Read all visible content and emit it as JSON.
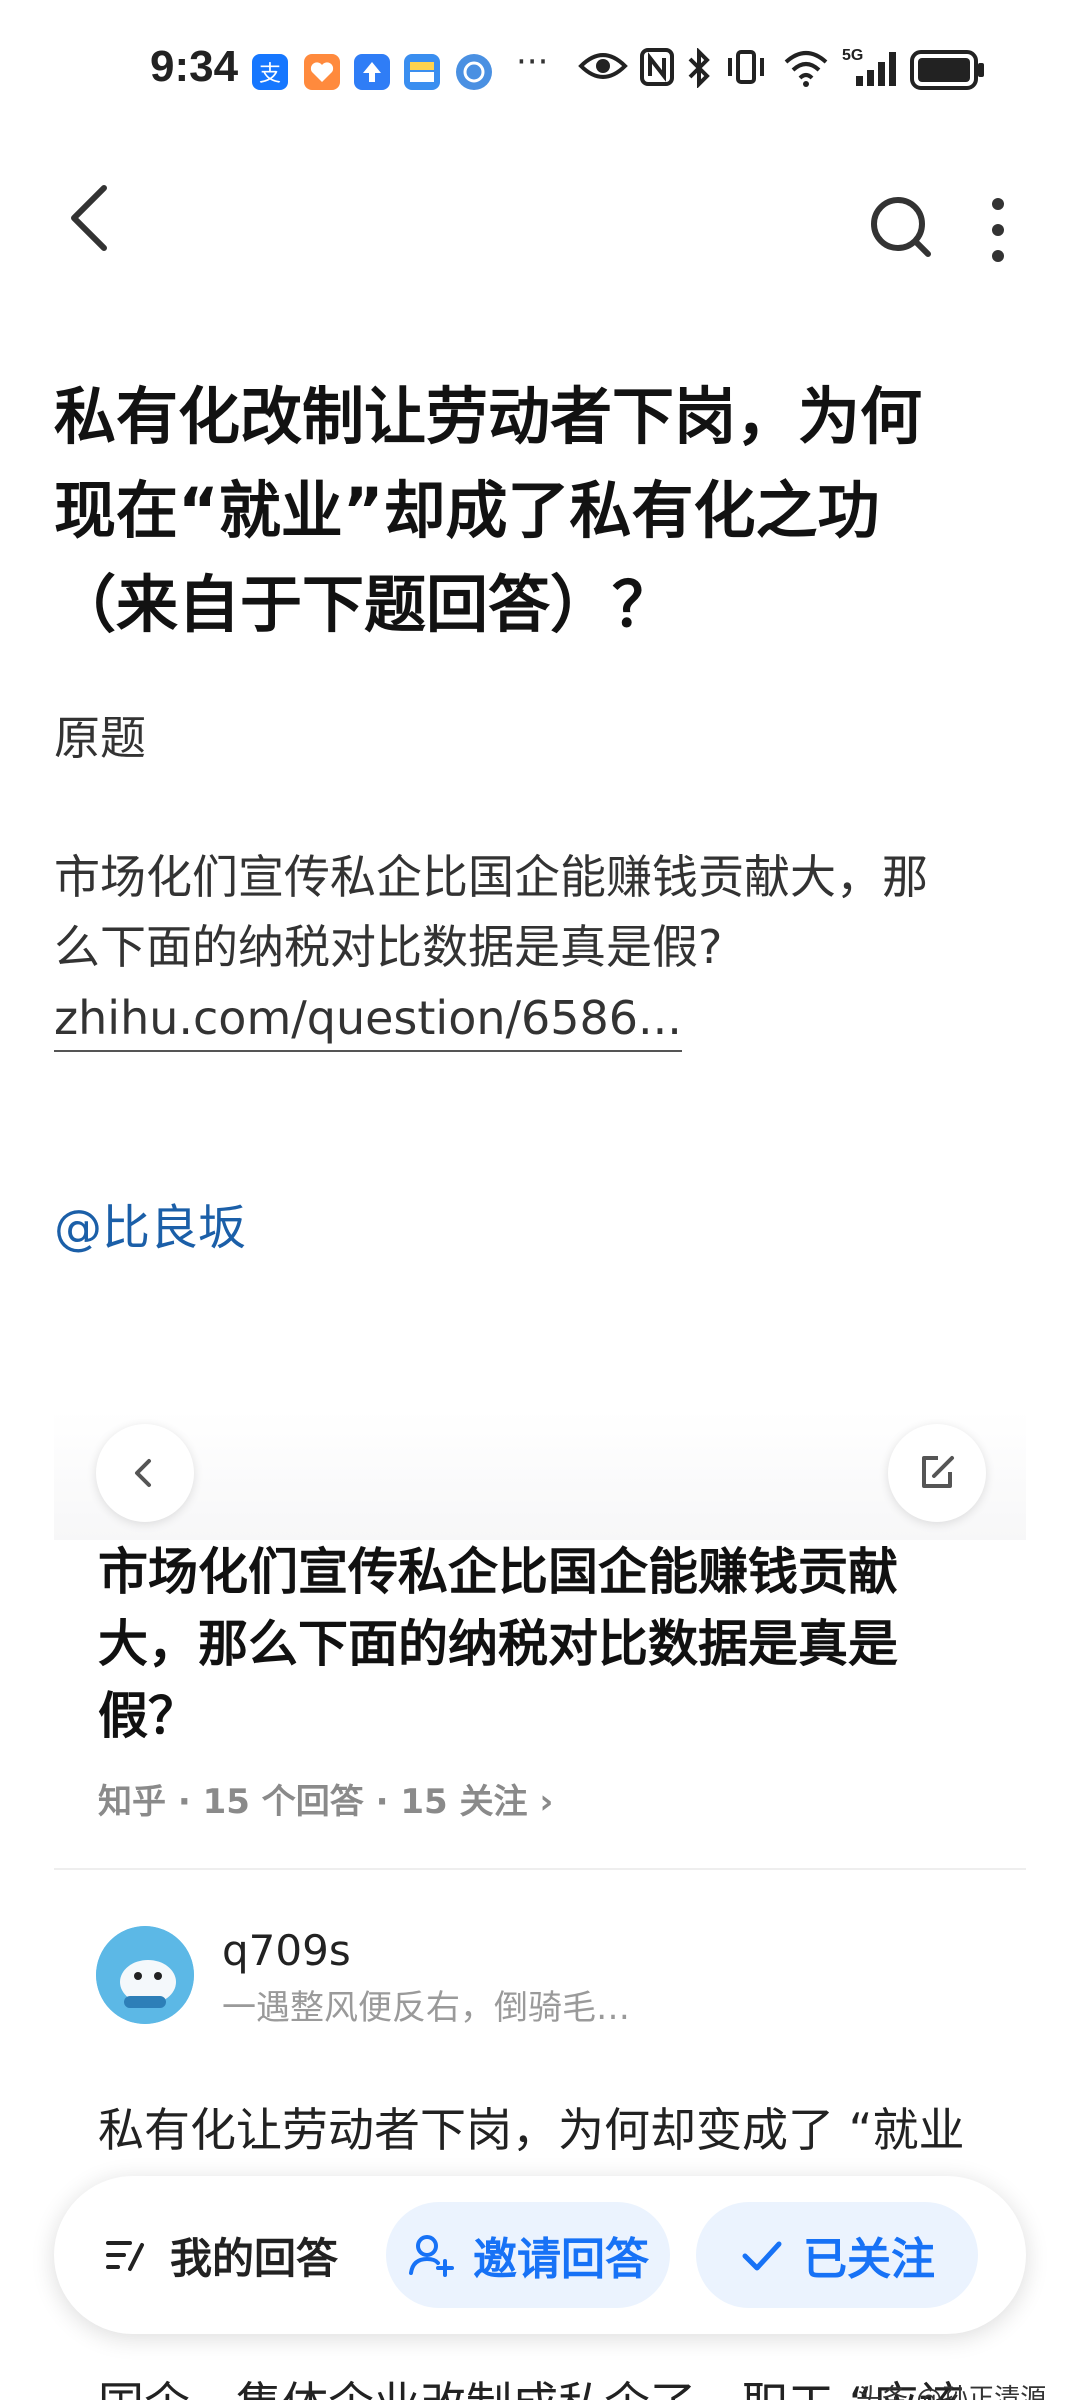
{
  "status_bar": {
    "time": "9:34",
    "overflow": "···",
    "app_icons": [
      "alipay-icon",
      "health-icon",
      "upload-icon",
      "wallet-icon",
      "browser-icon"
    ],
    "network_label": "5G",
    "indicators": [
      "eye-icon",
      "nfc-icon",
      "bluetooth-icon",
      "vibrate-icon",
      "wifi-icon",
      "signal-icon",
      "battery-icon"
    ]
  },
  "nav": {
    "back_icon": "chevron-left-icon",
    "search_icon": "search-icon",
    "more_icon": "more-vertical-icon"
  },
  "article": {
    "title_lines": [
      "私有化改制让劳动者下岗，为何",
      "现在“就业”却成了私有化之功",
      "（来自于下题回答）？"
    ],
    "section_label": "原题",
    "question_lines": [
      "市场化们宣传私企比国企能赚钱贡献大，那",
      "么下面的纳税对比数据是真是假?"
    ],
    "question_link": "zhihu.com/question/6586...",
    "mention": "@比良坂"
  },
  "card": {
    "title_lines": [
      "市场化们宣传私企比国企能赚钱贡献",
      "大，那么下面的纳税对比数据是真是",
      "假？"
    ],
    "meta": "知乎 · 15 个回答 · 15 关注 ›",
    "author": {
      "name": "q709s",
      "bio": "一遇整风便反右，倒骑毛…"
    },
    "answer_line_1": "私有化让劳动者下岗，为何却变成了 “就业",
    "answer_line_2": "国企、集体企业改制成私企了，职工 “应该"
  },
  "actions": {
    "my_answer": "我的回答",
    "invite": "邀请回答",
    "following": "已关注"
  },
  "watermark": "头条 @孙正清源",
  "colors": {
    "accent": "#1772f6",
    "pill_bg": "#ebf3fe",
    "mention": "#1b5fa8"
  }
}
